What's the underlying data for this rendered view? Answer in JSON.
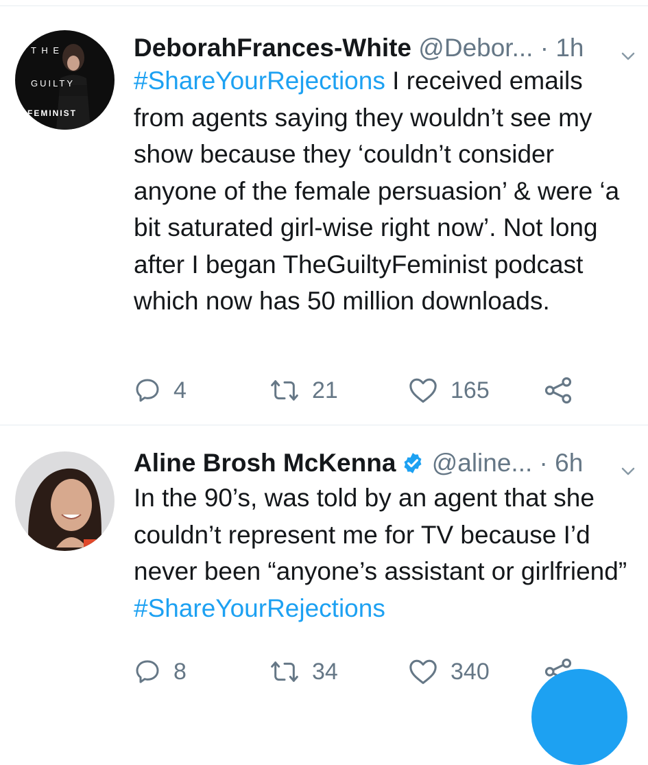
{
  "tweets": [
    {
      "name": "DeborahFrances-White",
      "handle": "@Debor...",
      "dot": "·",
      "time": "1h",
      "verified": false,
      "body_segments": [
        {
          "text": "#ShareYourRejections",
          "hashtag": true
        },
        {
          "text": " I received emails from agents saying they wouldn’t see my show because they ‘couldn’t consider anyone of the female persuasion’ & were ‘a bit saturated girl-wise right now’. Not long after I began TheGuiltyFeminist podcast which now has 50 million downloads.",
          "hashtag": false
        }
      ],
      "avatar_text": {
        "line1": "T H E",
        "line2": "GUILTY",
        "line3": "FEMINIST"
      },
      "replies": "4",
      "retweets": "21",
      "likes": "165"
    },
    {
      "name": "Aline Brosh McKenna",
      "handle": "@aline...",
      "dot": "·",
      "time": "6h",
      "verified": true,
      "body_segments": [
        {
          "text": "In the 90’s, was told by an agent that she couldn’t represent me for TV because I’d never been “anyone’s assistant or girlfriend” ",
          "hashtag": false
        },
        {
          "text": "#ShareYourRejections",
          "hashtag": true
        }
      ],
      "replies": "8",
      "retweets": "34",
      "likes": "340"
    }
  ],
  "icons": {
    "reply": "reply-icon",
    "retweet": "retweet-icon",
    "like": "heart-icon",
    "share": "share-icon",
    "caret": "chevron-down-icon",
    "verified": "verified-badge-icon"
  },
  "colors": {
    "accent": "#1da1f2",
    "text": "#14171a",
    "muted": "#657786",
    "divider": "#e6ecf0"
  }
}
